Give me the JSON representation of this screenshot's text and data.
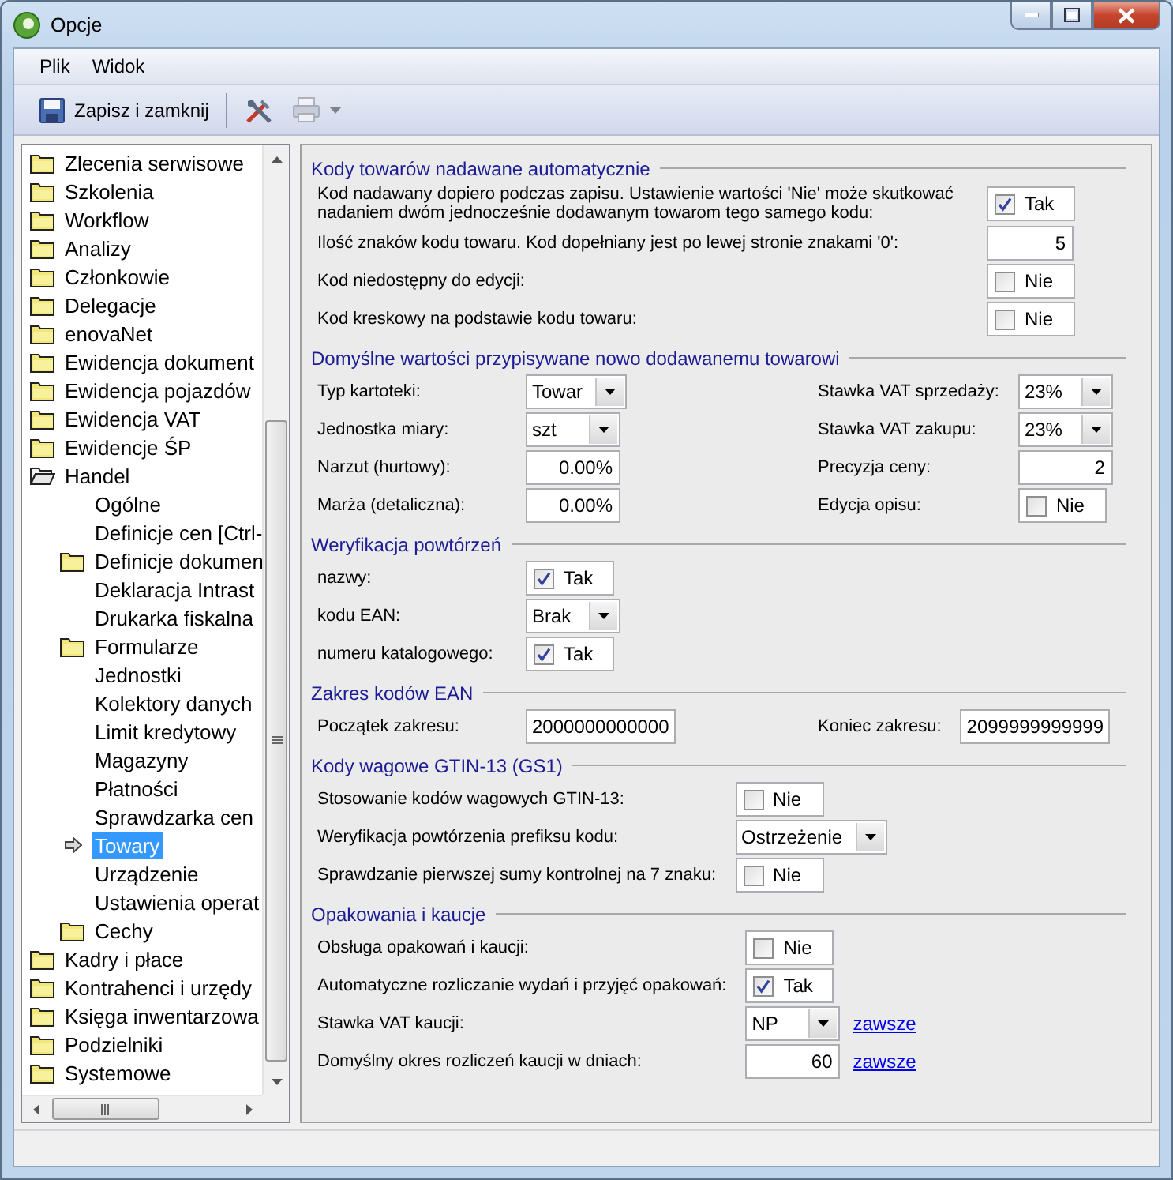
{
  "window": {
    "title": "Opcje"
  },
  "menu": [
    "Plik",
    "Widok"
  ],
  "toolbar": [
    {
      "kind": "save",
      "label": "Zapisz i zamknij"
    },
    {
      "kind": "separator"
    },
    {
      "kind": "tools"
    },
    {
      "kind": "print-menu",
      "disabled": true
    }
  ],
  "tree": [
    {
      "label": "Zlecenia serwisowe",
      "kind": "folder",
      "expanded": false,
      "selected": false
    },
    {
      "label": "Szkolenia",
      "kind": "folder",
      "expanded": false,
      "selected": false
    },
    {
      "label": "Workflow",
      "kind": "folder",
      "expanded": false,
      "selected": false
    },
    {
      "label": "Analizy",
      "kind": "folder",
      "expanded": false,
      "selected": false
    },
    {
      "label": "Członkowie",
      "kind": "folder",
      "expanded": false,
      "selected": false
    },
    {
      "label": "Delegacje",
      "kind": "folder",
      "expanded": false,
      "selected": false
    },
    {
      "label": "enovaNet",
      "kind": "folder",
      "expanded": false,
      "selected": false
    },
    {
      "label": "Ewidencja dokument",
      "kind": "folder",
      "expanded": false,
      "selected": false
    },
    {
      "label": "Ewidencja pojazdów",
      "kind": "folder",
      "expanded": false,
      "selected": false
    },
    {
      "label": "Ewidencja VAT",
      "kind": "folder",
      "expanded": false,
      "selected": false
    },
    {
      "label": "Ewidencje ŚP",
      "kind": "folder",
      "expanded": false,
      "selected": false
    },
    {
      "label": "Handel",
      "kind": "folder",
      "expanded": true,
      "selected": false,
      "children": [
        {
          "label": "Ogólne",
          "kind": "leaf",
          "selected": false
        },
        {
          "label": "Definicje cen [Ctrl-",
          "kind": "leaf",
          "selected": false
        },
        {
          "label": "Definicje dokumen",
          "kind": "folder",
          "expanded": false,
          "selected": false
        },
        {
          "label": "Deklaracja Intrast",
          "kind": "leaf",
          "selected": false
        },
        {
          "label": "Drukarka fiskalna",
          "kind": "leaf",
          "selected": false
        },
        {
          "label": "Formularze",
          "kind": "folder",
          "expanded": false,
          "selected": false
        },
        {
          "label": "Jednostki",
          "kind": "leaf",
          "selected": false
        },
        {
          "label": "Kolektory danych",
          "kind": "leaf",
          "selected": false
        },
        {
          "label": "Limit kredytowy",
          "kind": "leaf",
          "selected": false
        },
        {
          "label": "Magazyny",
          "kind": "leaf",
          "selected": false
        },
        {
          "label": "Płatności",
          "kind": "leaf",
          "selected": false
        },
        {
          "label": "Sprawdzarka cen",
          "kind": "leaf",
          "selected": false
        },
        {
          "label": "Towary",
          "kind": "leaf",
          "selected": true
        },
        {
          "label": "Urządzenie",
          "kind": "leaf",
          "selected": false
        },
        {
          "label": "Ustawienia operat",
          "kind": "leaf",
          "selected": false
        },
        {
          "label": "Cechy",
          "kind": "folder",
          "expanded": false,
          "selected": false
        }
      ]
    },
    {
      "label": "Kadry i płace",
      "kind": "folder",
      "expanded": false,
      "selected": false
    },
    {
      "label": "Kontrahenci i urzędy",
      "kind": "folder",
      "expanded": false,
      "selected": false
    },
    {
      "label": "Księga inwentarzowa",
      "kind": "folder",
      "expanded": false,
      "selected": false
    },
    {
      "label": "Podzielniki",
      "kind": "folder",
      "expanded": false,
      "selected": false
    },
    {
      "label": "Systemowe",
      "kind": "folder",
      "expanded": false,
      "selected": false
    }
  ],
  "sections": [
    {
      "title": "Kody towarów nadawane automatycznie",
      "kind": "wide",
      "rows": [
        {
          "label": "Kod nadawany dopiero podczas zapisu. Ustawienie wartości 'Nie' może skutkować nadaniem dwóm jednocześnie dodawanym towarom tego samego kodu:",
          "field": {
            "kind": "checkbox",
            "checked": true,
            "value": "Tak"
          }
        },
        {
          "label": "Ilość znaków kodu towaru. Kod dopełniany jest po lewej stronie znakami '0':",
          "field": {
            "kind": "number",
            "value": "5"
          }
        },
        {
          "label": "Kod niedostępny do edycji:",
          "field": {
            "kind": "checkbox",
            "checked": false,
            "value": "Nie"
          }
        },
        {
          "label": "Kod kreskowy na podstawie kodu towaru:",
          "field": {
            "kind": "checkbox",
            "checked": false,
            "value": "Nie"
          }
        }
      ]
    },
    {
      "title": "Domyślne wartości przypisywane nowo dodawanemu towarowi",
      "kind": "grid",
      "rows": [
        {
          "label": "Typ kartoteki:",
          "field": {
            "kind": "combo",
            "value": "Towar"
          }
        },
        {
          "label": "Stawka VAT sprzedaży:",
          "field": {
            "kind": "combo",
            "value": "23%"
          }
        },
        {
          "label": "Jednostka miary:",
          "field": {
            "kind": "combo",
            "value": "szt"
          }
        },
        {
          "label": "Stawka VAT zakupu:",
          "field": {
            "kind": "combo",
            "value": "23%"
          }
        },
        {
          "label": "Narzut (hurtowy):",
          "field": {
            "kind": "number",
            "value": "0.00%"
          }
        },
        {
          "label": "Precyzja ceny:",
          "field": {
            "kind": "number",
            "value": "2"
          }
        },
        {
          "label": "Marża (detaliczna):",
          "field": {
            "kind": "number",
            "value": "0.00%"
          }
        },
        {
          "label": "Edycja opisu:",
          "field": {
            "kind": "checkbox",
            "checked": false,
            "value": "Nie"
          }
        }
      ]
    },
    {
      "title": "Weryfikacja powtórzeń",
      "kind": "list",
      "rows": [
        {
          "label": "nazwy:",
          "field": {
            "kind": "checkbox",
            "checked": true,
            "value": "Tak"
          }
        },
        {
          "label": "kodu EAN:",
          "field": {
            "kind": "combo",
            "value": "Brak"
          }
        },
        {
          "label": "numeru katalogowego:",
          "field": {
            "kind": "checkbox",
            "checked": true,
            "value": "Tak"
          }
        }
      ]
    },
    {
      "title": "Zakres kodów EAN",
      "kind": "grid",
      "rows": [
        {
          "label": "Początek zakresu:",
          "field": {
            "kind": "text",
            "value": "2000000000000"
          }
        },
        {
          "label": "Koniec zakresu:",
          "field": {
            "kind": "text",
            "value": "2099999999999"
          }
        }
      ]
    },
    {
      "title": "Kody wagowe GTIN-13 (GS1)",
      "kind": "list",
      "rows": [
        {
          "label": "Stosowanie kodów wagowych GTIN-13:",
          "field": {
            "kind": "checkbox",
            "checked": false,
            "value": "Nie"
          }
        },
        {
          "label": "Weryfikacja powtórzenia prefiksu kodu:",
          "field": {
            "kind": "combo",
            "value": "Ostrzeżenie"
          }
        },
        {
          "label": "Sprawdzanie pierwszej sumy kontrolnej na 7 znaku:",
          "field": {
            "kind": "checkbox",
            "checked": false,
            "value": "Nie"
          }
        }
      ]
    },
    {
      "title": "Opakowania i kaucje",
      "kind": "list",
      "rows": [
        {
          "label": "Obsługa opakowań i kaucji:",
          "field": {
            "kind": "checkbox",
            "checked": false,
            "value": "Nie"
          }
        },
        {
          "label": "Automatyczne rozliczanie wydań i przyjęć opakowań:",
          "field": {
            "kind": "checkbox",
            "checked": true,
            "value": "Tak"
          }
        },
        {
          "label": "Stawka VAT kaucji:",
          "field": {
            "kind": "combo",
            "value": "NP"
          },
          "link": "zawsze"
        },
        {
          "label": "Domyślny okres rozliczeń kaucji w dniach:",
          "field": {
            "kind": "number",
            "value": "60"
          },
          "link": "zawsze"
        }
      ]
    }
  ]
}
